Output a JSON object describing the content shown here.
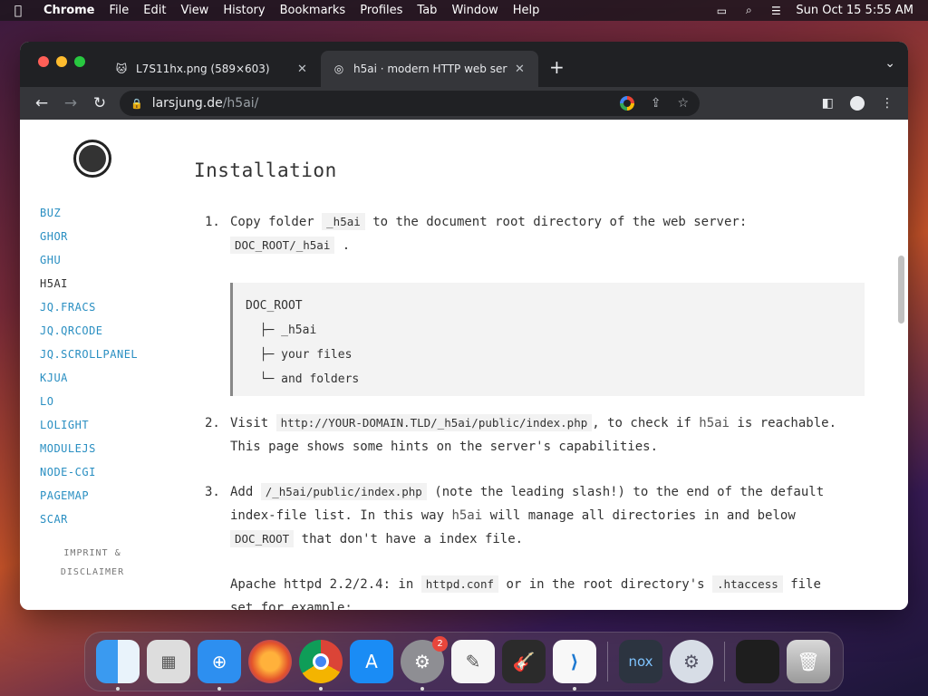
{
  "menubar": {
    "app": "Chrome",
    "items": [
      "File",
      "Edit",
      "View",
      "History",
      "Bookmarks",
      "Profiles",
      "Tab",
      "Window",
      "Help"
    ],
    "clock": "Sun Oct 15  5:55 AM"
  },
  "tabs": [
    {
      "title": "L7S11hx.png (589×603)",
      "close": "✕"
    },
    {
      "title": "h5ai · modern HTTP web serve",
      "close": "✕"
    }
  ],
  "new_tab": "+",
  "address": {
    "host": "larsjung.de",
    "path": "/h5ai/"
  },
  "sidebar": {
    "items": [
      "BUZ",
      "GHOR",
      "GHU",
      "H5AI",
      "JQ.FRACS",
      "JQ.QRCODE",
      "JQ.SCROLLPANEL",
      "KJUA",
      "LO",
      "LOLIGHT",
      "MODULEJS",
      "NODE-CGI",
      "PAGEMAP",
      "SCAR"
    ],
    "current": "H5AI",
    "imprint_line1": "IMPRINT &",
    "imprint_line2": "DISCLAIMER"
  },
  "content": {
    "heading": "Installation",
    "step1": {
      "num": "1.",
      "text1": "Copy folder",
      "code1": "_h5ai",
      "text2": "to the document root directory of the web server:",
      "code2": "DOC_ROOT/_h5ai",
      "text3": "."
    },
    "tree": [
      "DOC_ROOT",
      "  ├─ _h5ai",
      "  ├─ your files",
      "  └─ and folders"
    ],
    "step2": {
      "num": "2.",
      "text1": "Visit",
      "code1": "http://YOUR-DOMAIN.TLD/_h5ai/public/index.php",
      "text2": ", to check if",
      "em": "h5ai",
      "text3": "is reachable. This page shows some hints on the server's capabilities."
    },
    "step3": {
      "num": "3.",
      "text1": "Add",
      "code1": "/_h5ai/public/index.php",
      "text2": "(note the leading slash!) to the end of the default index-file list. In this way",
      "em": "h5ai",
      "text3": "will manage all directories in and below",
      "code2": "DOC_ROOT",
      "text4": "that don't have a index file."
    },
    "apache": {
      "text1": "Apache httpd 2.2/2.4: in",
      "code1": "httpd.conf",
      "text2": "or in the root directory's",
      "code2": ".htaccess",
      "text3": "file",
      "text4": "set for example:"
    }
  },
  "dock": {
    "badge": "2",
    "apps": [
      "Finder",
      "Launchpad",
      "Safari",
      "Firefox",
      "Chrome",
      "App Store",
      "System Preferences",
      "TextEdit",
      "GarageBand",
      "VS Code",
      "Nox",
      "Settings",
      "Finder Window",
      "Trash"
    ]
  }
}
